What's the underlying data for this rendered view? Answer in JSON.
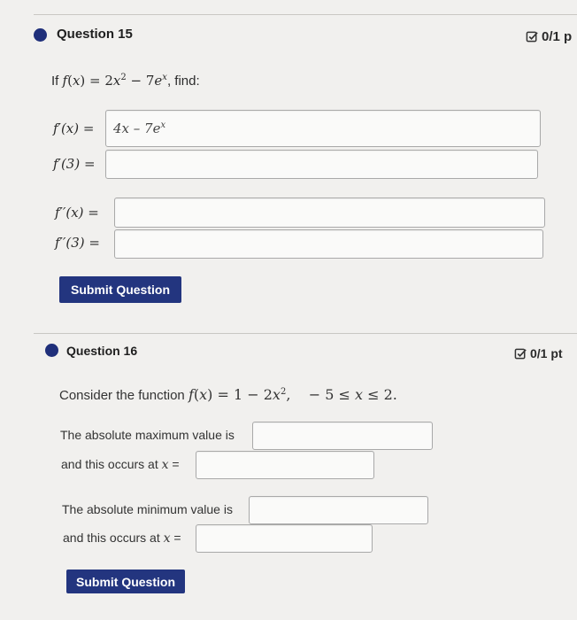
{
  "q15": {
    "title": "Question 15",
    "score": "0/1 p",
    "prompt_prefix": "If",
    "prompt_suffix": ", find:",
    "fp_value": "4x – 7e",
    "fp_label": "f′(x) =",
    "fp3_label": "f′(3) =",
    "fpp_label": "f′′(x) =",
    "fpp3_label": "f′′(3) =",
    "submit_label": "Submit Question"
  },
  "q16": {
    "title": "Question 16",
    "score": "0/1 pt",
    "consider_text": "Consider the function",
    "max_text": "The absolute maximum value is",
    "max_at_text": "and this occurs at",
    "min_text": "The absolute minimum value is",
    "min_at_text": "and this occurs at",
    "submit_label": "Submit Question"
  },
  "colors": {
    "accent": "#23357f",
    "dot": "#1f2f7a",
    "background": "#f1f0ee"
  }
}
